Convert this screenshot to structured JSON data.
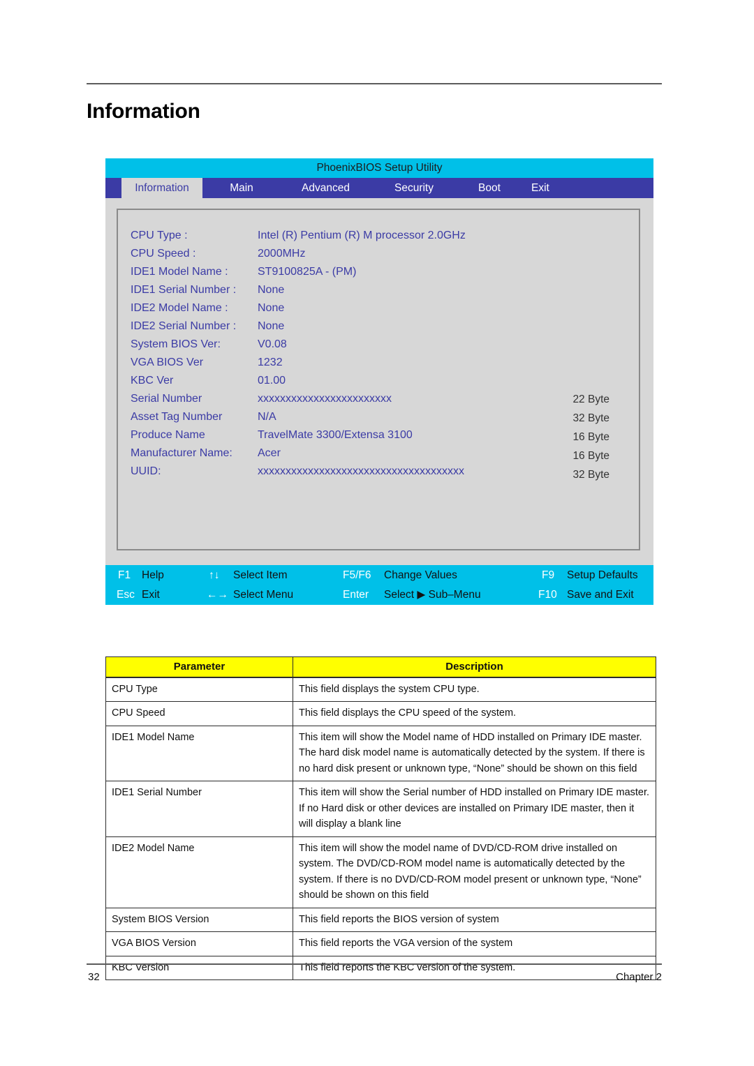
{
  "page": {
    "title": "Information",
    "footer_page_number": "32",
    "footer_chapter": "Chapter 2"
  },
  "colors": {
    "bios_titlebar": "#00c0e8",
    "bios_menubar": "#3b3ba5",
    "bios_background": "#d7d7d7",
    "bios_text": "#3b3ba5",
    "fkey_bar": "#00c0e8",
    "table_header": "#ffff00"
  },
  "bios": {
    "utility_title": "PhoenixBIOS Setup Utility",
    "menu": [
      {
        "label": "Information",
        "active": true
      },
      {
        "label": "Main",
        "active": false
      },
      {
        "label": "Advanced",
        "active": false
      },
      {
        "label": "Security",
        "active": false
      },
      {
        "label": "Boot",
        "active": false
      },
      {
        "label": "Exit",
        "active": false
      }
    ],
    "fields": [
      {
        "label": "CPU Type :",
        "value": "Intel (R) Pentium (R) M processor 2.0GHz"
      },
      {
        "label": "CPU Speed :",
        "value": "2000MHz"
      },
      {
        "label": "IDE1 Model Name :",
        "value": "ST9100825A - (PM)"
      },
      {
        "label": "IDE1 Serial Number :",
        "value": "None"
      },
      {
        "label": "IDE2 Model Name :",
        "value": "None"
      },
      {
        "label": "IDE2 Serial Number :",
        "value": "None"
      },
      {
        "label": "System BIOS Ver:",
        "value": "V0.08"
      },
      {
        "label": "VGA BIOS Ver",
        "value": "1232"
      },
      {
        "label": "KBC Ver",
        "value": "01.00"
      },
      {
        "label": "Serial Number",
        "value": "xxxxxxxxxxxxxxxxxxxxxxxx"
      },
      {
        "label": "Asset Tag Number",
        "value": "N/A"
      },
      {
        "label": "Produce Name",
        "value": "TravelMate 3300/Extensa 3100"
      },
      {
        "label": "Manufacturer Name:",
        "value": "Acer"
      },
      {
        "label": "UUID:",
        "value": "xxxxxxxxxxxxxxxxxxxxxxxxxxxxxxxxxxxxx"
      }
    ],
    "byte_sizes": [
      "22 Byte",
      "32 Byte",
      "16 Byte",
      "16 Byte",
      "32 Byte"
    ],
    "function_keys": {
      "row1": [
        {
          "key": "F1",
          "text": "Help"
        },
        {
          "key": "↑↓",
          "text": "Select Item"
        },
        {
          "key": "F5/F6",
          "text": "Change Values"
        },
        {
          "key": "F9",
          "text": "Setup Defaults"
        }
      ],
      "row2": [
        {
          "key": "Esc",
          "text": "Exit"
        },
        {
          "key": "←→",
          "text": "Select Menu"
        },
        {
          "key": "Enter",
          "text": "Select ▶ Sub–Menu"
        },
        {
          "key": "F10",
          "text": "Save and Exit"
        }
      ]
    }
  },
  "parameter_table": {
    "headers": [
      "Parameter",
      "Description"
    ],
    "rows": [
      {
        "parameter": "CPU Type",
        "description": "This field displays the system CPU type."
      },
      {
        "parameter": "CPU Speed",
        "description": "This field displays the CPU speed of the system."
      },
      {
        "parameter": "IDE1 Model Name",
        "description": "This item will show the Model name of HDD installed on Primary IDE master. The hard disk model name is automatically detected by the system. If there is no hard disk present or unknown type, “None” should be shown on this field"
      },
      {
        "parameter": "IDE1 Serial Number",
        "description": "This item will show the Serial number of HDD installed on Primary IDE master. If no Hard disk or other devices are installed on Primary IDE master, then it will display a blank line"
      },
      {
        "parameter": "IDE2 Model Name",
        "description": "This item will show the model name of DVD/CD-ROM drive installed on system. The DVD/CD-ROM model name is automatically detected by the system. If there is no DVD/CD-ROM model present or unknown type, “None” should be shown on this field"
      },
      {
        "parameter": "System BIOS Version",
        "description": "This field reports the BIOS version of system"
      },
      {
        "parameter": "VGA BIOS Version",
        "description": "This field reports the VGA version of the system"
      },
      {
        "parameter": "KBC Version",
        "description": "This field reports the KBC version of the system."
      }
    ]
  }
}
